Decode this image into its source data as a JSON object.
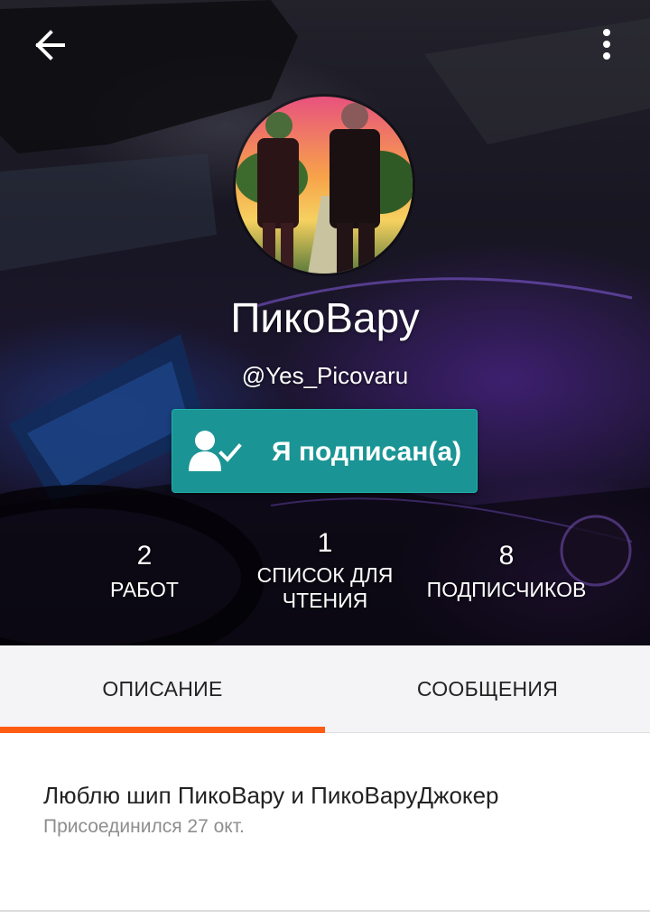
{
  "header": {
    "back_icon": "arrow-left-icon",
    "more_icon": "more-vertical-icon"
  },
  "profile": {
    "name": "ПикоВару",
    "username": "@Yes_Picovaru",
    "avatar_description_icon": "avatar-image"
  },
  "follow_button": {
    "label": "Я подписан(а)",
    "icon": "user-check-icon",
    "color": "#1a9494"
  },
  "stats": [
    {
      "value": "2",
      "label": "РАБОТ"
    },
    {
      "value": "1",
      "label_line1": "СПИСОК ДЛЯ",
      "label_line2": "ЧТЕНИЯ"
    },
    {
      "value": "8",
      "label": "ПОДПИСЧИКОВ"
    }
  ],
  "tabs": [
    {
      "label": "ОПИСАНИЕ",
      "active": true
    },
    {
      "label": "СООБЩЕНИЯ",
      "active": false
    }
  ],
  "accent_color": "#ff5c13",
  "about": {
    "bio": "Люблю шип ПикоВару и ПикоВаруДжокер",
    "joined": "Присоединился 27 окт."
  }
}
